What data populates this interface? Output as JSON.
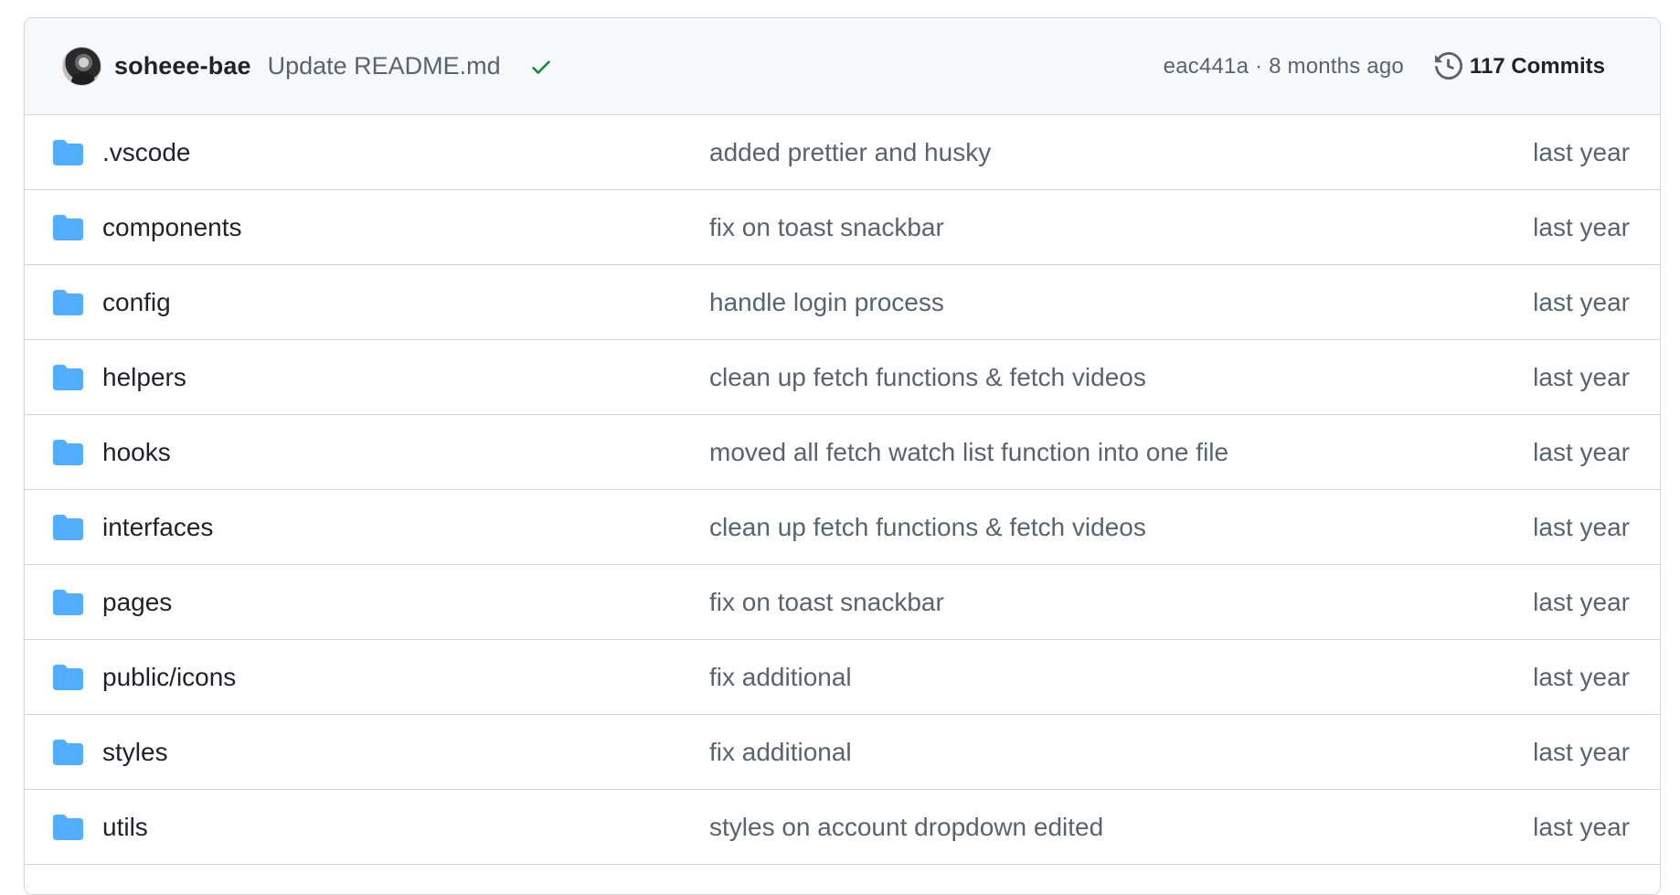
{
  "latest_commit": {
    "author": "soheee-bae",
    "message": "Update README.md",
    "sha_time": "eac441a · 8 months ago",
    "commits_label": "117 Commits",
    "status_color": "#1a7f37"
  },
  "colors": {
    "folder": "#54aeff",
    "border": "#d0d7de",
    "header_bg": "#f6f8fa",
    "muted_text": "#59636e",
    "text": "#1f2328"
  },
  "files": [
    {
      "icon": "folder-icon",
      "name": ".vscode",
      "message": "added prettier and husky",
      "age": "last year"
    },
    {
      "icon": "folder-icon",
      "name": "components",
      "message": "fix on toast snackbar",
      "age": "last year"
    },
    {
      "icon": "folder-icon",
      "name": "config",
      "message": "handle login process",
      "age": "last year"
    },
    {
      "icon": "folder-icon",
      "name": "helpers",
      "message": "clean up fetch functions & fetch videos",
      "age": "last year"
    },
    {
      "icon": "folder-icon",
      "name": "hooks",
      "message": "moved all fetch watch list function into one file",
      "age": "last year"
    },
    {
      "icon": "folder-icon",
      "name": "interfaces",
      "message": "clean up fetch functions & fetch videos",
      "age": "last year"
    },
    {
      "icon": "folder-icon",
      "name": "pages",
      "message": "fix on toast snackbar",
      "age": "last year"
    },
    {
      "icon": "folder-icon",
      "name": "public/icons",
      "message": "fix additional",
      "age": "last year"
    },
    {
      "icon": "folder-icon",
      "name": "styles",
      "message": "fix additional",
      "age": "last year"
    },
    {
      "icon": "folder-icon",
      "name": "utils",
      "message": "styles on account dropdown edited",
      "age": "last year"
    }
  ]
}
